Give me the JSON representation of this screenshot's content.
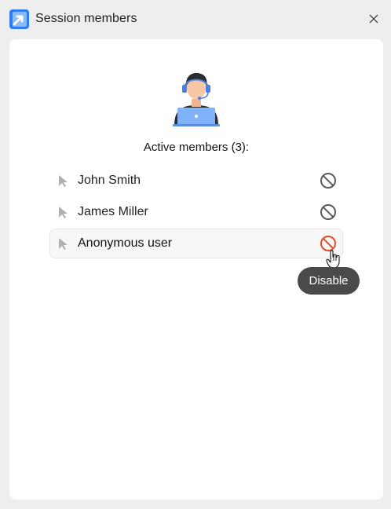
{
  "window": {
    "title": "Session members"
  },
  "panel": {
    "heading": "Active members (3):"
  },
  "members": [
    {
      "name": "John Smith"
    },
    {
      "name": "James Miller"
    },
    {
      "name": "Anonymous user"
    }
  ],
  "tooltip": {
    "text": "Disable"
  },
  "icons": {
    "app": "remote-access-arrow-icon",
    "close": "close-icon",
    "avatar": "support-agent-laptop-icon",
    "member": "pointer-cursor-icon",
    "disable": "ban-icon",
    "cursor": "hand-cursor-icon"
  },
  "colors": {
    "app_icon": "#2f7cf6",
    "ban_default": "#5a5a5a",
    "ban_active": "#e84a2a",
    "tooltip_bg": "#4a4a4a",
    "laptop": "#7fb2f8"
  }
}
